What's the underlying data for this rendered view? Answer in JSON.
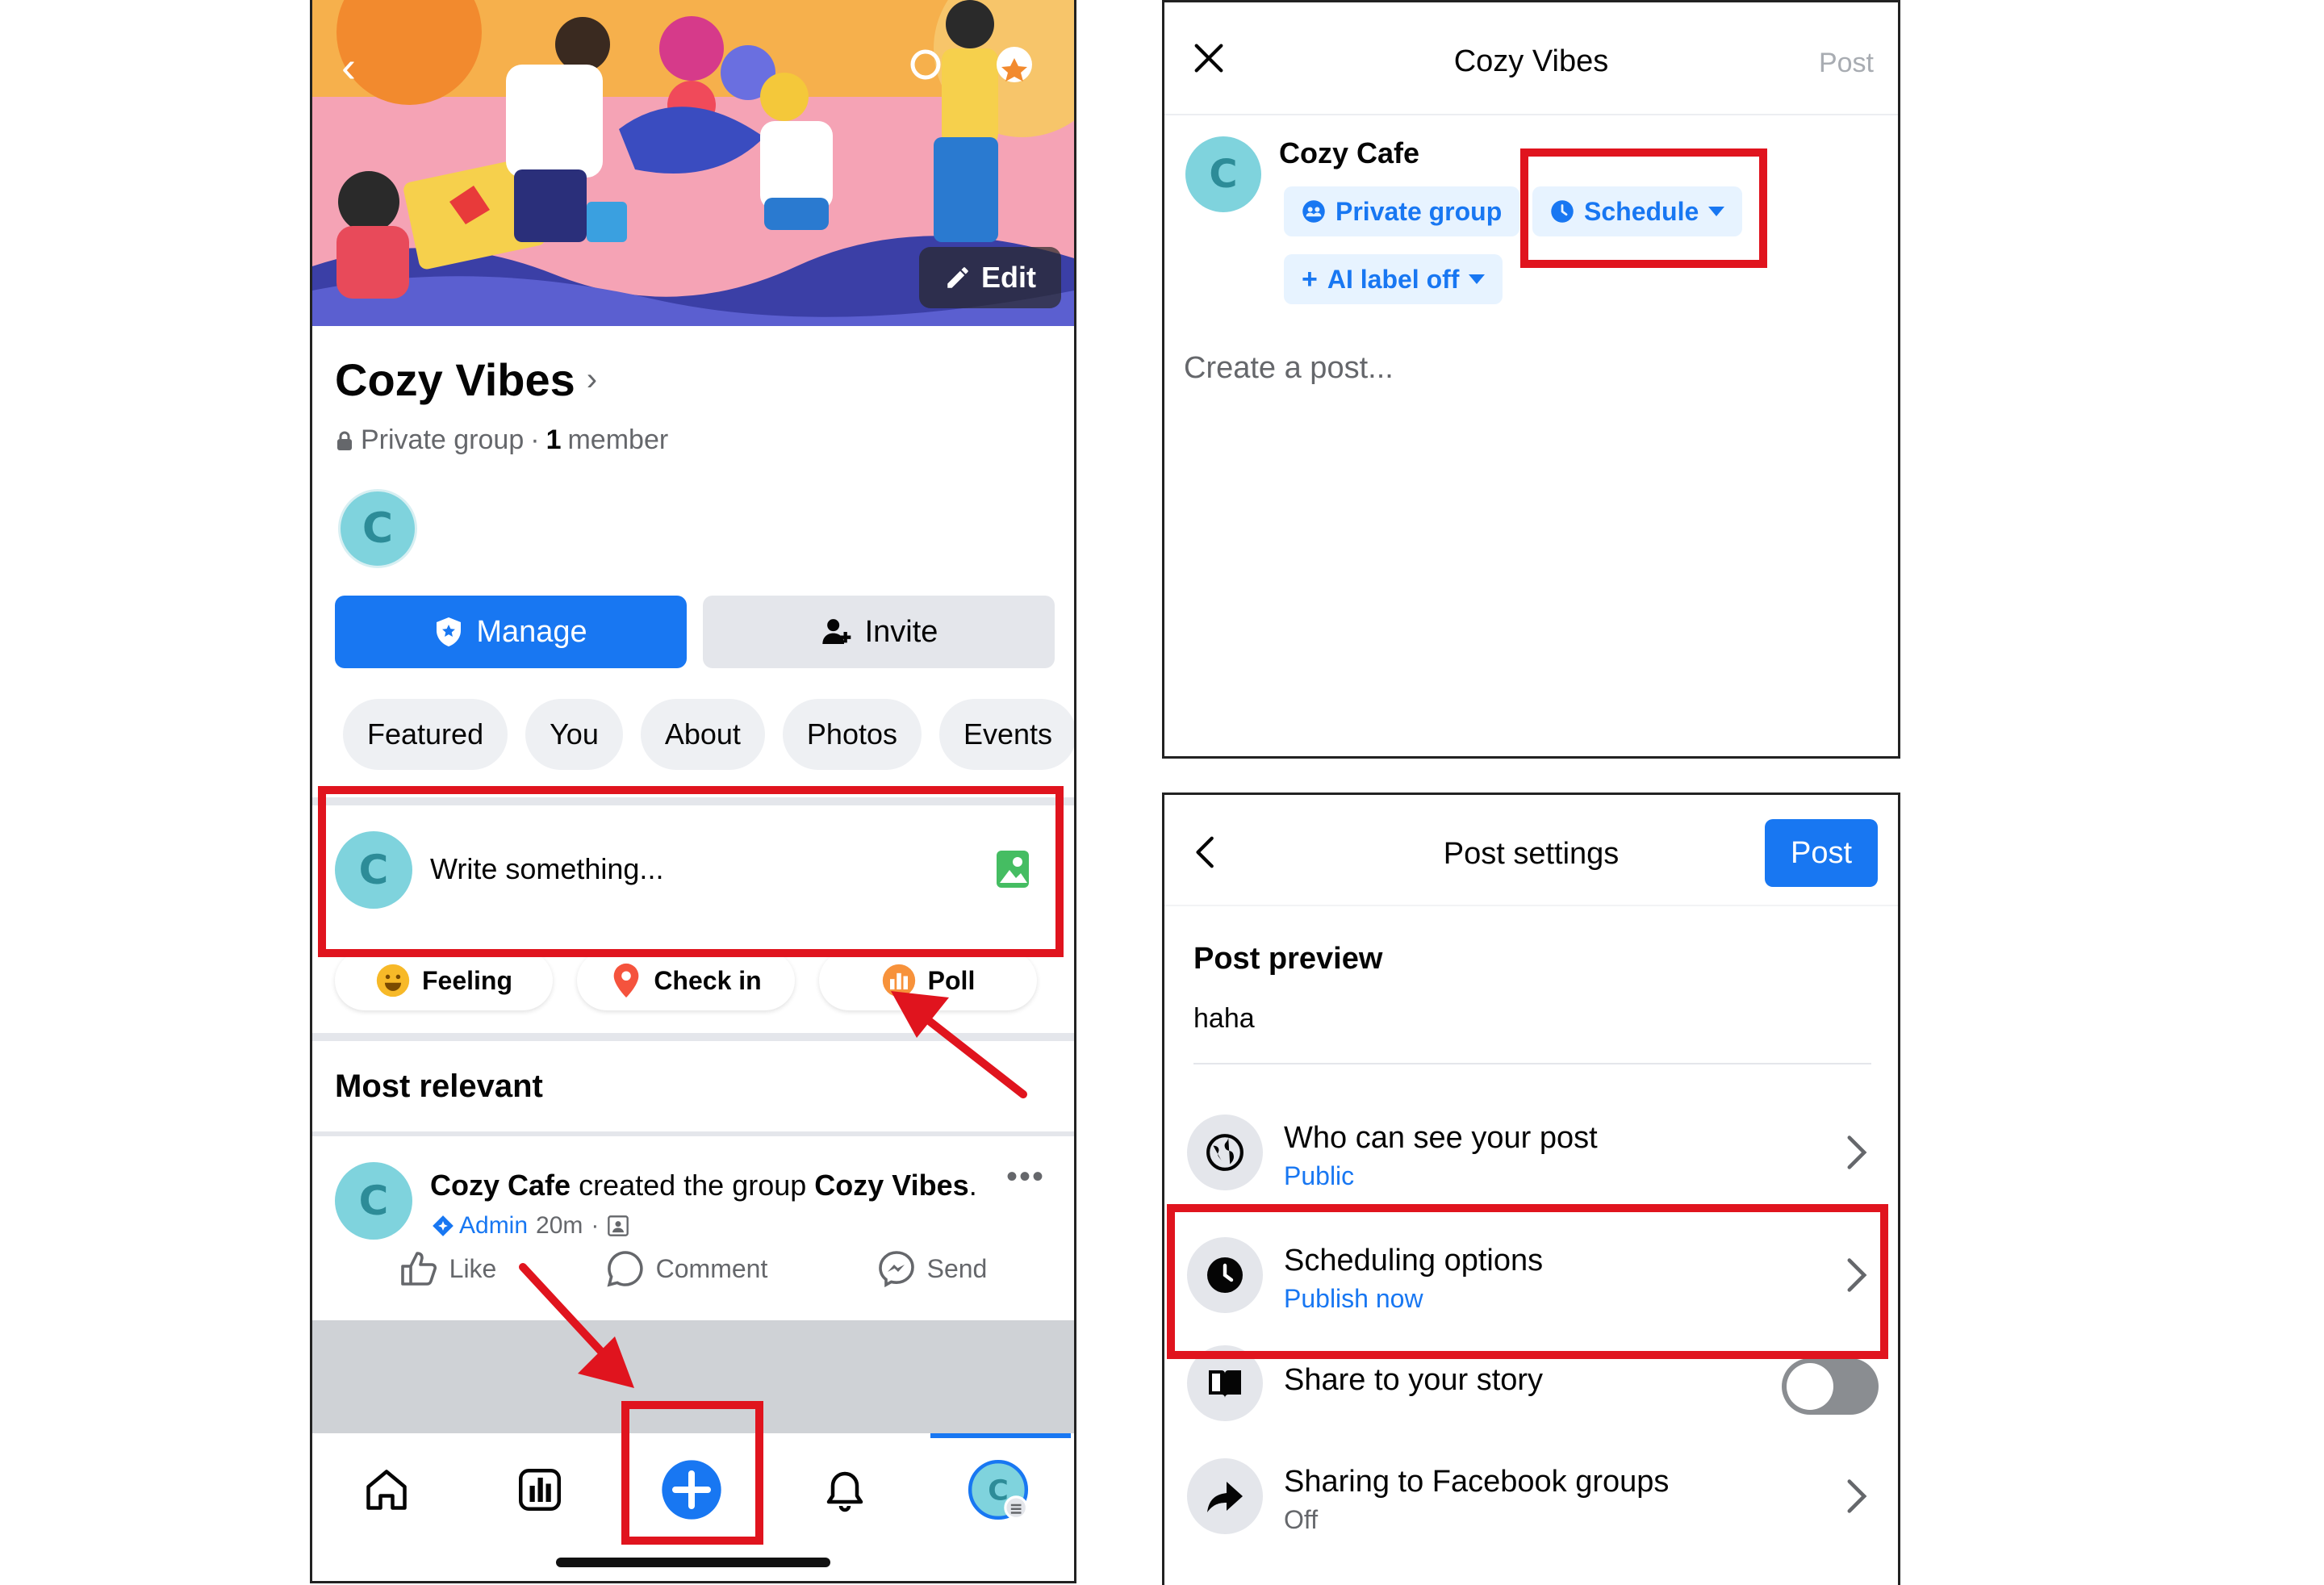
{
  "left": {
    "cover": {
      "edit_label": "Edit",
      "back_icon": "chevron-left-icon"
    },
    "group": {
      "title": "Cozy Vibes",
      "privacy": "Private group",
      "member_count": "1",
      "member_word": "member",
      "avatar_letter": "C"
    },
    "buttons": {
      "manage": "Manage",
      "invite": "Invite"
    },
    "tabs": [
      "Featured",
      "You",
      "About",
      "Photos",
      "Events"
    ],
    "composer": {
      "placeholder": "Write something...",
      "avatar_letter": "C"
    },
    "actions": [
      "Feeling",
      "Check in",
      "Poll"
    ],
    "section_title": "Most relevant",
    "post": {
      "author": "Cozy Cafe",
      "verb": "created the group",
      "group": "Cozy Vibes",
      "badge": "Admin",
      "time": "20m",
      "like": "Like",
      "comment": "Comment",
      "send": "Send",
      "avatar_letter": "C"
    },
    "nav": [
      "home-icon",
      "feed-icon",
      "create-icon",
      "notifications-icon",
      "profile-icon"
    ]
  },
  "right_top": {
    "title": "Cozy Vibes",
    "post_label": "Post",
    "author": "Cozy Cafe",
    "avatar_letter": "C",
    "chips": {
      "privacy": "Private group",
      "schedule": "Schedule",
      "ai_label": "AI label off"
    },
    "placeholder": "Create a post..."
  },
  "right_bottom": {
    "title": "Post settings",
    "post_button": "Post",
    "preview_label": "Post preview",
    "preview_text": "haha",
    "rows": [
      {
        "title": "Who can see your post",
        "sub": "Public"
      },
      {
        "title": "Scheduling options",
        "sub": "Publish now"
      },
      {
        "title": "Share to your story",
        "toggle": "off"
      },
      {
        "title": "Sharing to Facebook groups",
        "sub": "Off"
      }
    ]
  },
  "colors": {
    "accent": "#1877f2",
    "highlight": "#e0141e",
    "avatar_bg": "#7fd3dd"
  }
}
